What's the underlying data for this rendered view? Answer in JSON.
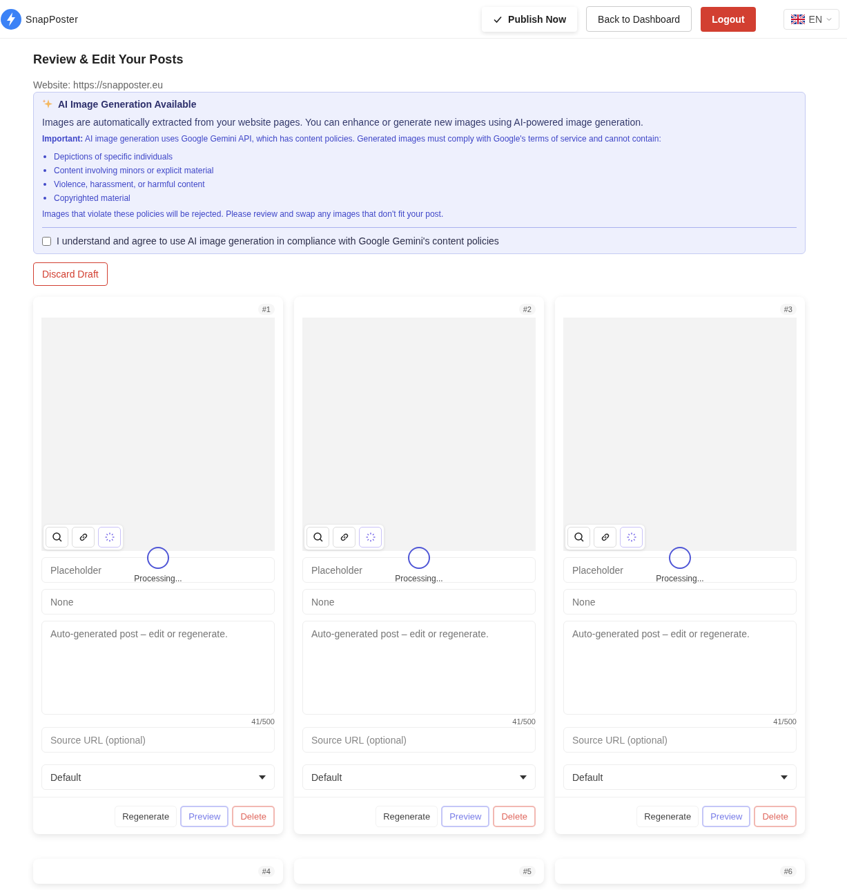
{
  "header": {
    "brand": "SnapPoster",
    "publish_button": "Publish Now",
    "dashboard_button": "Back to Dashboard",
    "logout_button": "Logout",
    "language": "EN"
  },
  "page_title": "Review & Edit Your Posts",
  "website": "Website: https://snapposter.eu",
  "notice": {
    "title": "AI Image Generation Available",
    "intro": "Images are automatically extracted from your website pages. You can enhance or generate new images using AI-powered image generation.",
    "important": "**Important:** AI image generation uses Google Gemini API, which has content policies. Generated images must comply with Google's terms of service and cannot contain:",
    "items": [
      "Depictions of specific individuals",
      "Content involving minors or explicit material",
      "Violence, harassment, or harmful content",
      "Copyrighted material"
    ],
    "footer": "Images that violate these policies will be rejected. Please review and swap any images that don't fit your post.",
    "consent": {
      "label": "I understand and agree to use AI image generation in compliance with Google Gemini's content policies",
      "checked": false
    }
  },
  "discard_button": "Discard Draft",
  "posts": [
    {
      "number": "#1",
      "processing": "Processing...",
      "title": "Placeholder",
      "field_2": "None",
      "body": "Auto-generated post – edit or regenerate.",
      "counter": "41/500",
      "source_placeholder": "Source URL (optional)",
      "style": "Default",
      "actions": [
        "Regenerate",
        "Preview",
        "Delete"
      ]
    },
    {
      "number": "#2",
      "processing": "Processing...",
      "title": "Placeholder",
      "field_2": "None",
      "body": "Auto-generated post – edit or regenerate.",
      "counter": "41/500",
      "source_placeholder": "Source URL (optional)",
      "style": "Default",
      "actions": [
        "Regenerate",
        "Preview",
        "Delete"
      ]
    },
    {
      "number": "#3",
      "processing": "Processing...",
      "title": "Placeholder",
      "field_2": "None",
      "body": "Auto-generated post – edit or regenerate.",
      "counter": "41/500",
      "source_placeholder": "Source URL (optional)",
      "style": "Default",
      "actions": [
        "Regenerate",
        "Preview",
        "Delete"
      ]
    },
    {
      "number": "#4"
    },
    {
      "number": "#5"
    },
    {
      "number": "#6"
    }
  ]
}
